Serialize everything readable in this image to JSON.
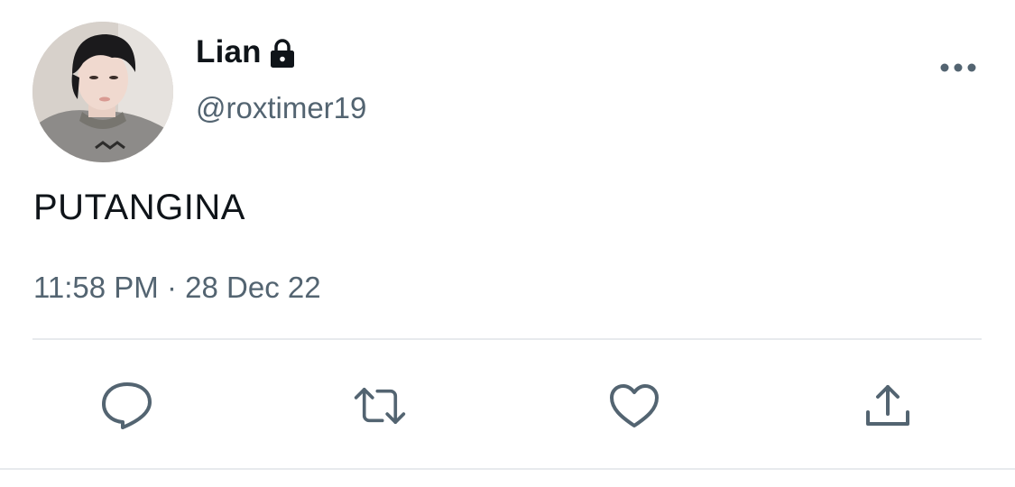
{
  "tweet": {
    "display_name": "Lian",
    "handle": "@roxtimer19",
    "text": "PUTANGINA",
    "time": "11:58 PM",
    "separator": "·",
    "date": "28 Dec 22"
  },
  "icons": {
    "lock": "lock-icon",
    "more": "more-icon",
    "reply": "reply-icon",
    "retweet": "retweet-icon",
    "like": "heart-icon",
    "share": "share-icon"
  },
  "colors": {
    "text": "#0f1419",
    "secondary": "#536471",
    "icon": "#536471",
    "divider": "#e7eaed"
  }
}
